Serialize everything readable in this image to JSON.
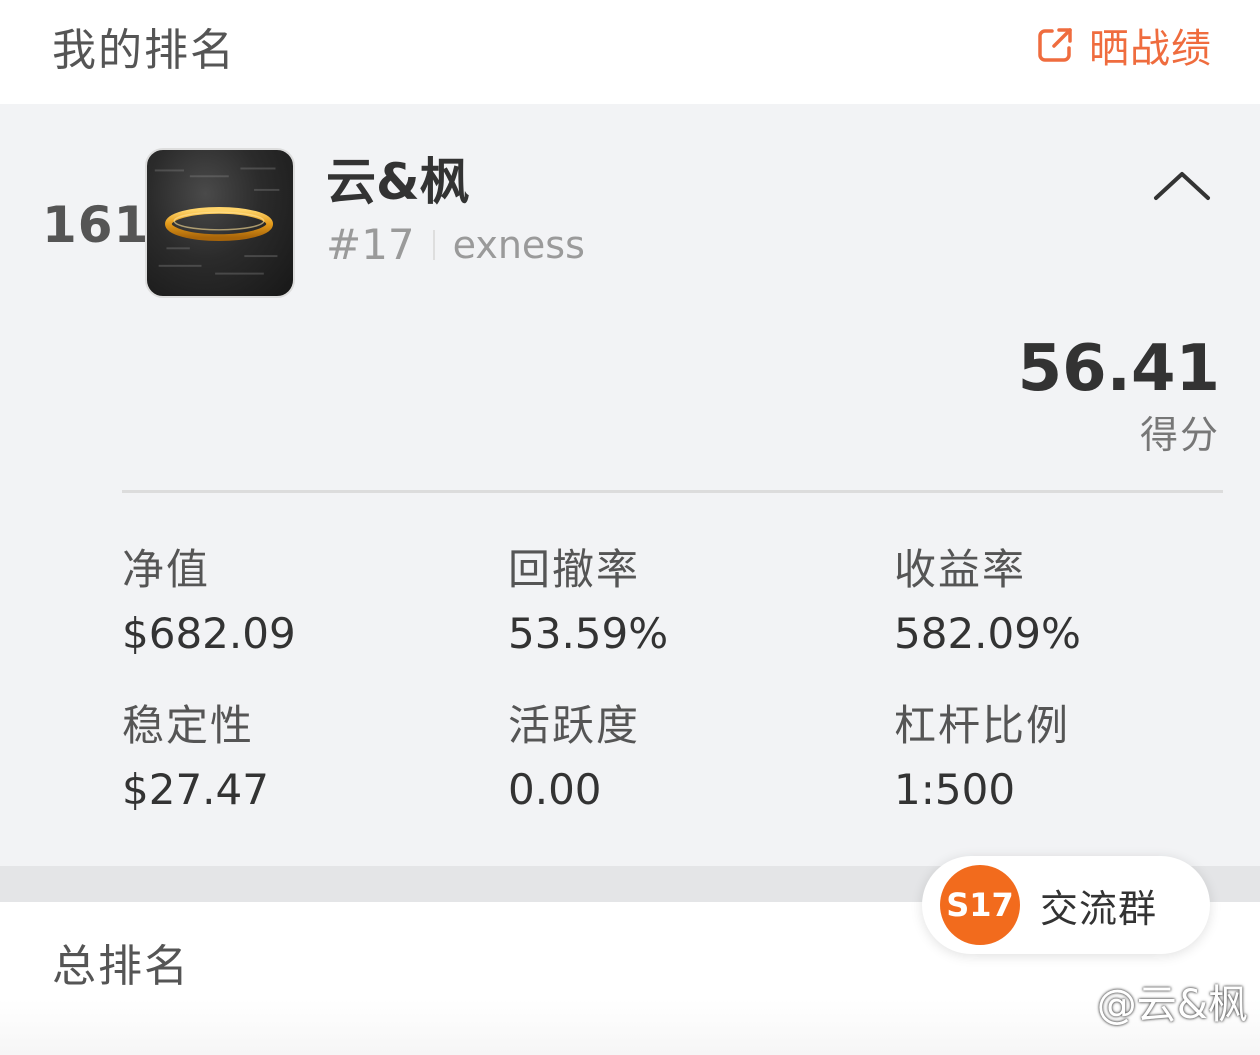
{
  "header": {
    "title": "我的排名",
    "share_icon": "share-external-icon",
    "share_label": "晒战绩",
    "accent_color": "#ef6c3e"
  },
  "rank_card": {
    "rank": "161",
    "avatar_icon": "gold-ring-avatar",
    "name": "云&枫",
    "id": "#17",
    "broker": "exness",
    "collapse_icon": "chevron-up-icon",
    "score": "56.41",
    "score_label": "得分",
    "stats": [
      {
        "label": "净值",
        "value": "$682.09"
      },
      {
        "label": "回撤率",
        "value": "53.59%"
      },
      {
        "label": "收益率",
        "value": "582.09%"
      },
      {
        "label": "稳定性",
        "value": "$27.47"
      },
      {
        "label": "活跃度",
        "value": "0.00"
      },
      {
        "label": "杠杆比例",
        "value": "1:500"
      }
    ]
  },
  "overall": {
    "title": "总排名"
  },
  "group_button": {
    "badge": "S17",
    "label": "交流群",
    "badge_color": "#f26b1d"
  },
  "watermark": "@云&枫"
}
